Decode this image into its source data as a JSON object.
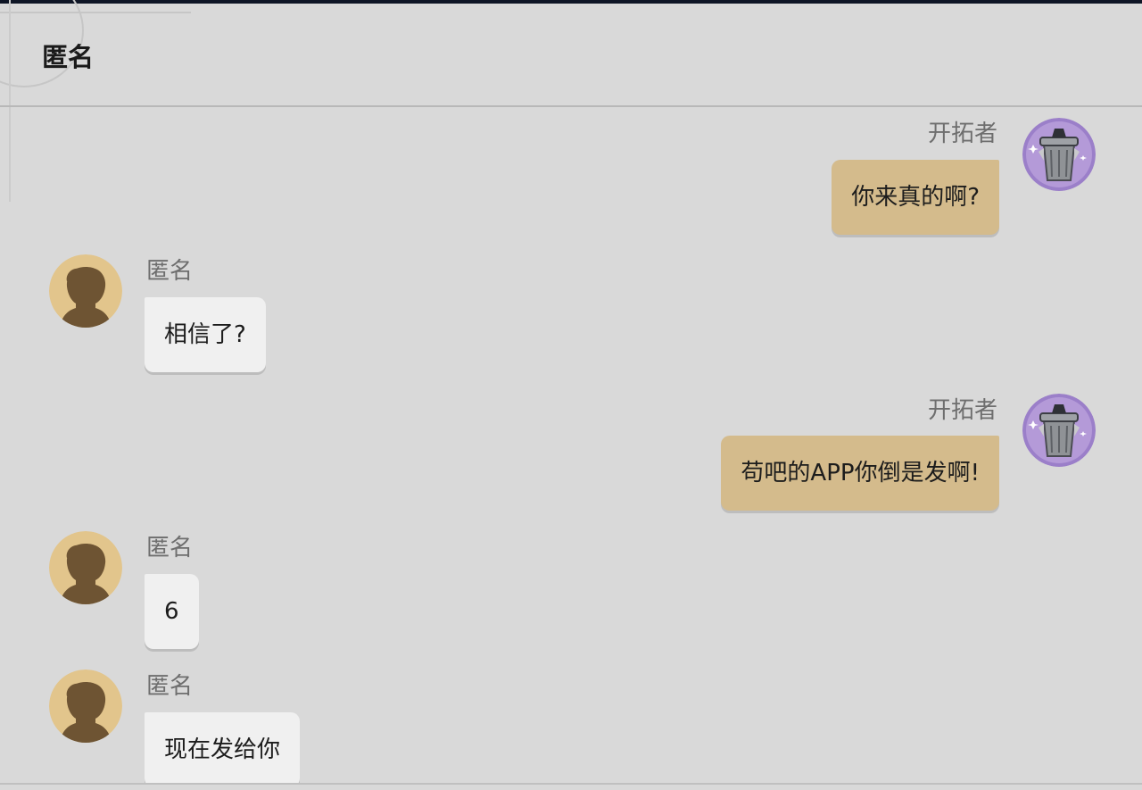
{
  "header": {
    "title": "匿名"
  },
  "colors": {
    "background": "#d9d9d9",
    "self_bubble": "#d4bb8c",
    "other_bubble": "#f0f0f0",
    "name_text": "#6e6e6e",
    "self_avatar_bg": "#9b7fc9",
    "other_avatar_bg": "#e2c58c"
  },
  "messages": [
    {
      "sender": "self",
      "name": "开拓者",
      "text": "你来真的啊?",
      "avatar": "trash-can-avatar"
    },
    {
      "sender": "other",
      "name": "匿名",
      "text": "相信了?",
      "avatar": "silhouette-avatar"
    },
    {
      "sender": "self",
      "name": "开拓者",
      "text": "苟吧的APP你倒是发啊!",
      "avatar": "trash-can-avatar"
    },
    {
      "sender": "other",
      "name": "匿名",
      "text": "6",
      "avatar": "silhouette-avatar"
    },
    {
      "sender": "other",
      "name": "匿名",
      "text": "现在发给你",
      "avatar": "silhouette-avatar"
    }
  ]
}
